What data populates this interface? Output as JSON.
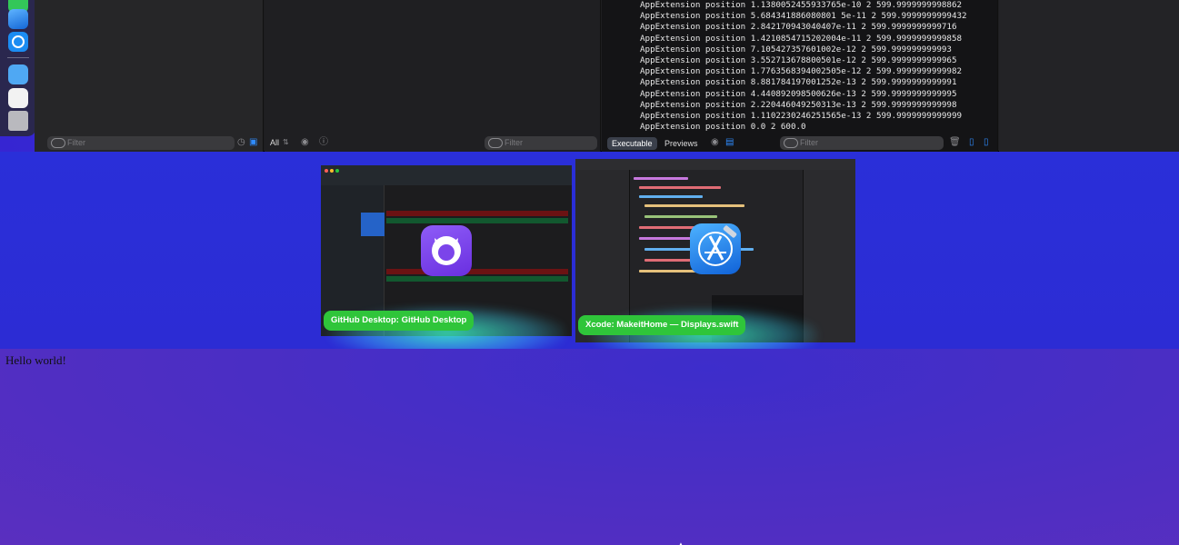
{
  "xcode": {
    "nav_filter_placeholder": "Filter",
    "editor_scope": "All",
    "editor_filter_placeholder": "Filter",
    "console_tabs": [
      "Executable",
      "Previews"
    ],
    "inspector_filter_placeholder": "Filter",
    "console_lines": [
      "AppExtension position 1.1380052455933765e-10 2 599.9999999998862",
      "AppExtension position 5.684341886080801 5e-11 2 599.9999999999432",
      "AppExtension position 2.842170943040407e-11 2 599.9999999999716",
      "AppExtension position 1.4210854715202004e-11 2 599.9999999999858",
      "AppExtension position 7.105427357601002e-12 2 599.999999999993",
      "AppExtension position 3.552713678800501e-12 2 599.9999999999965",
      "AppExtension position 1.7763568394002505e-12 2 599.9999999999982",
      "AppExtension position 8.881784197001252e-13 2 599.9999999999991",
      "AppExtension position 4.440892098500626e-13 2 599.9999999999995",
      "AppExtension position 2.220446049250313e-13 2 599.9999999999998",
      "AppExtension position 1.1102230246251565e-13 2 599.9999999999999",
      "AppExtension position 0.0 2 600.0"
    ]
  },
  "switcher": {
    "apps": [
      {
        "label": "GitHub Desktop: GitHub Desktop",
        "icon": "github-desktop-icon"
      },
      {
        "label": "Xcode: MakeitHome — Displays.swift",
        "icon": "xcode-icon"
      }
    ]
  },
  "page": {
    "text": "Hello world!"
  },
  "colors": {
    "accent_green": "#2fc53a",
    "background_blue": "#2a2fd9",
    "console_bg": "#141416"
  }
}
